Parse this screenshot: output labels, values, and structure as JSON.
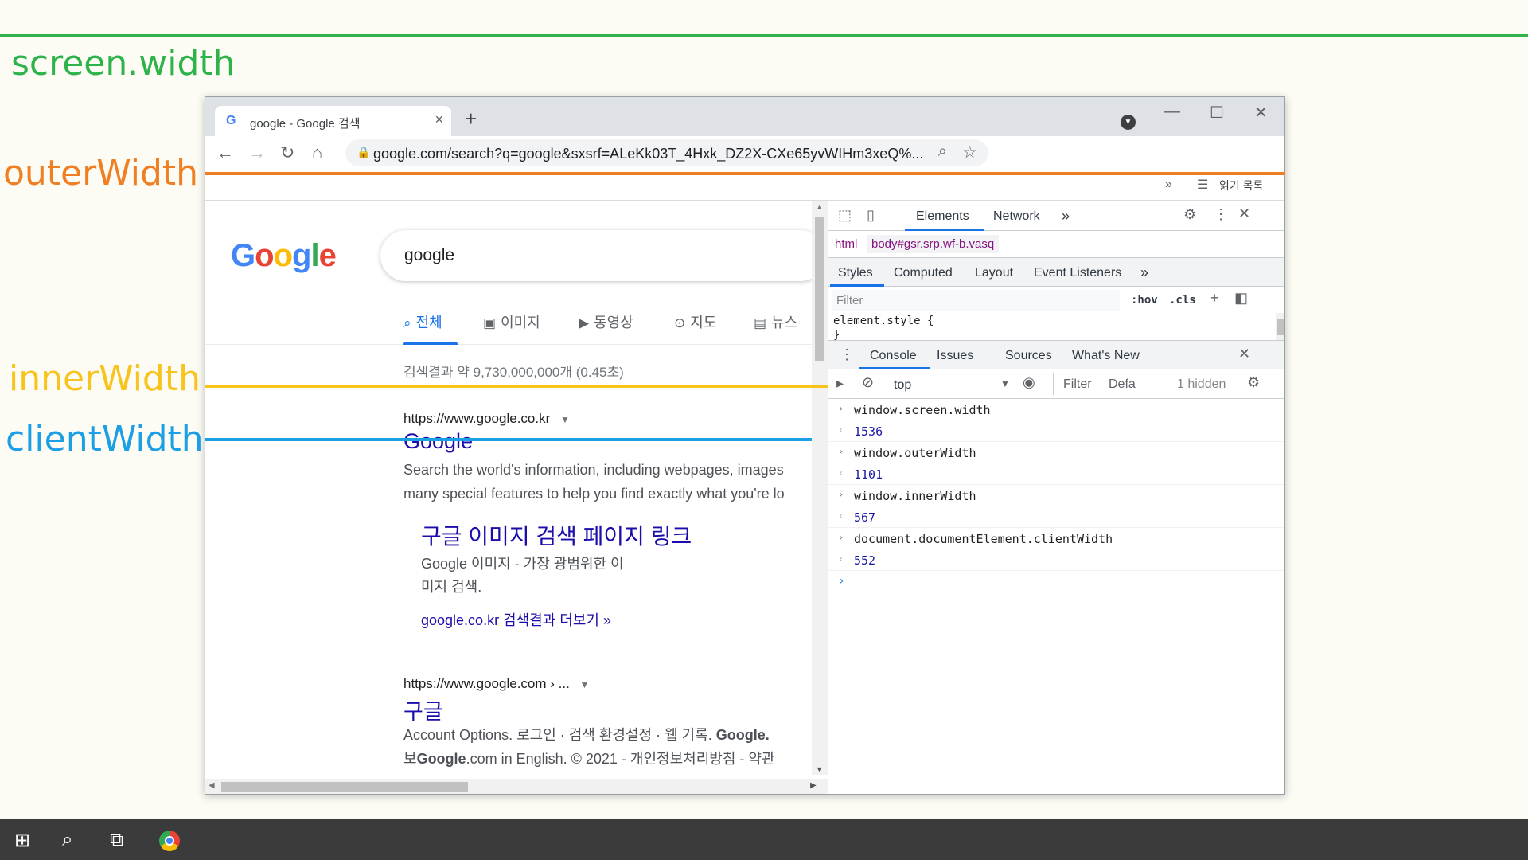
{
  "labels": {
    "screen_width": "screen.width",
    "outer_width": "outerWidth",
    "inner_width": "innerWidth",
    "client_width": "clientWidth"
  },
  "colors": {
    "screen": "#2db34a",
    "outer": "#f07f23",
    "inner": "#f8c31c",
    "client": "#1c9fe5"
  },
  "browser": {
    "tab_title": "google - Google 검색",
    "favicon": "G",
    "url": "google.com/search?q=google&sxsrf=ALeKk03T_4Hxk_DZ2X-CXe65yvWIHm3xeQ%...",
    "bookmarks_chevron": "»",
    "reading_list": "읽기 목록"
  },
  "google": {
    "logo": [
      "G",
      "o",
      "o",
      "g",
      "l",
      "e"
    ],
    "query": "google",
    "tabs": [
      {
        "icon": "search-icon",
        "label": "전체",
        "active": true
      },
      {
        "icon": "image-icon",
        "label": "이미지"
      },
      {
        "icon": "video-icon",
        "label": "동영상"
      },
      {
        "icon": "map-pin-icon",
        "label": "지도"
      },
      {
        "icon": "news-icon",
        "label": "뉴스"
      }
    ],
    "stats": "검색결과 약 9,730,000,000개 (0.45초)",
    "result1": {
      "url": "https://www.google.co.kr",
      "title": "Google",
      "snippet1": "Search the world's information, including webpages, images",
      "snippet2": "many special features to help you find exactly what you're lo"
    },
    "sublink": {
      "title": "구글 이미지 검색 페이지 링크",
      "snippet1": "Google 이미지 - 가장 광범위한 이",
      "snippet2": "미지 검색.",
      "more": "google.co.kr 검색결과 더보기 »"
    },
    "result2": {
      "url": "https://www.google.com › ...",
      "title": "구글",
      "snippet1_a": "Account Options. 로그인 · 검색 환경설정 · 웹 기록. ",
      "snippet1_b": "Google.",
      "snippet2_a": "보",
      "snippet2_b": "Google",
      "snippet2_c": ".com in English. © 2021 - 개인정보처리방침 - 약관"
    }
  },
  "devtools": {
    "tabs": [
      "Elements",
      "Network"
    ],
    "more": "»",
    "crumbs": [
      "html",
      "body#gsr.srp.wf-b.vasq"
    ],
    "styles_tabs": [
      "Styles",
      "Computed",
      "Layout",
      "Event Listeners"
    ],
    "filter_placeholder": "Filter",
    "hov": ":hov",
    "cls": ".cls",
    "element_style": "element.style {",
    "element_style_close": "}",
    "drawer_tabs": [
      "Console",
      "Issues",
      "Sources",
      "What's New"
    ],
    "context": "top",
    "console_filter": "Filter",
    "levels": "Defa",
    "hidden": "1 hidden",
    "console": [
      {
        "type": "in",
        "text": "window.screen.width"
      },
      {
        "type": "out",
        "text": "1536"
      },
      {
        "type": "in",
        "text": "window.outerWidth"
      },
      {
        "type": "out",
        "text": "1101"
      },
      {
        "type": "in",
        "text": "window.innerWidth"
      },
      {
        "type": "out",
        "text": "567"
      },
      {
        "type": "in",
        "text": "document.documentElement.clientWidth"
      },
      {
        "type": "out",
        "text": "552"
      }
    ]
  }
}
